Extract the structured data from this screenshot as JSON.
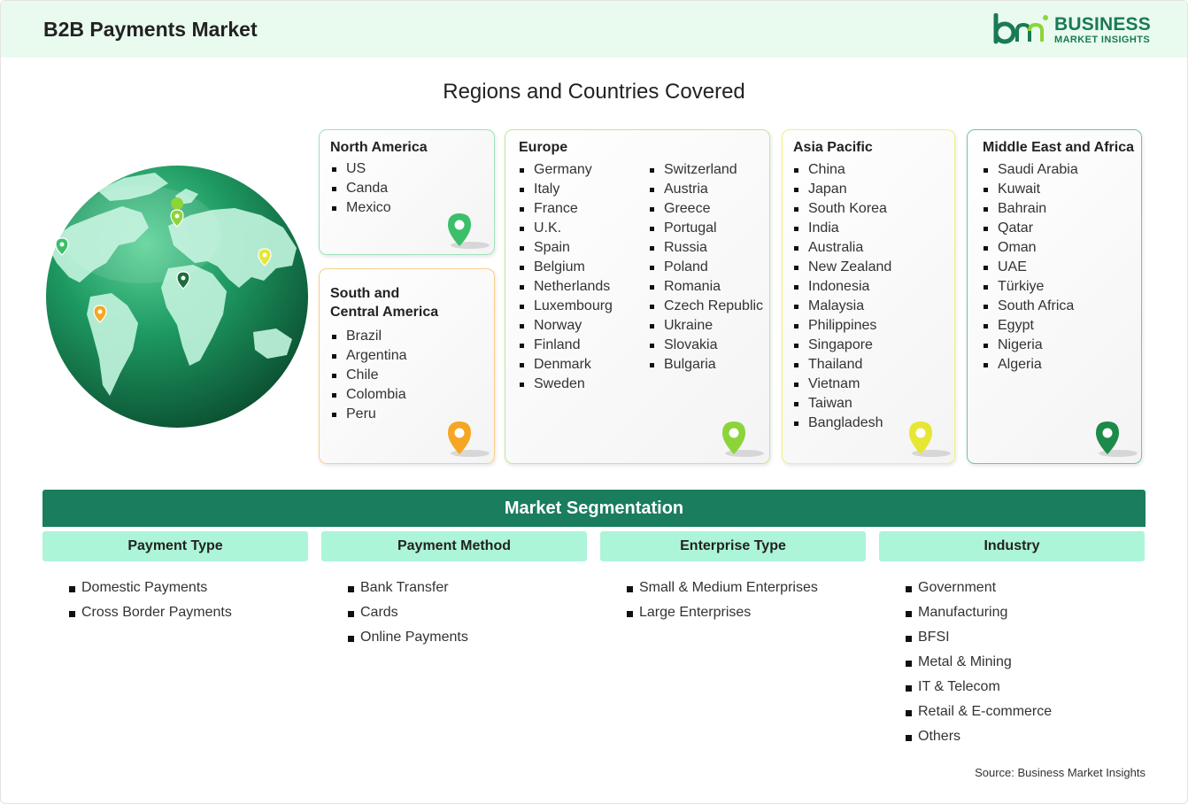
{
  "header": {
    "title": "B2B Payments Market"
  },
  "logo": {
    "line1": "BUSINESS",
    "line2": "MARKET INSIGHTS",
    "color": "#1a7a55"
  },
  "regions_title": "Regions and Countries Covered",
  "regions": {
    "north_america": {
      "title": "North America",
      "items": [
        "US",
        "Canda",
        "Mexico"
      ],
      "pin_color": "#3cbf6a"
    },
    "south_america": {
      "title_line1": "South and",
      "title_line2": "Central America",
      "items": [
        "Brazil",
        "Argentina",
        "Chile",
        "Colombia",
        "Peru"
      ],
      "pin_color": "#f5a623"
    },
    "europe": {
      "title": "Europe",
      "col1": [
        "Germany",
        "Italy",
        "France",
        "U.K.",
        "Spain",
        "Belgium",
        "Netherlands",
        "Luxembourg",
        "Norway",
        "Finland",
        "Denmark",
        "Sweden"
      ],
      "col2": [
        "Switzerland",
        "Austria",
        "Greece",
        "Portugal",
        "Russia",
        "Poland",
        "Romania",
        "Czech Republic",
        "Ukraine",
        "Slovakia",
        "Bulgaria"
      ],
      "pin_color": "#8cd43a"
    },
    "asia_pacific": {
      "title": "Asia Pacific",
      "items": [
        "China",
        "Japan",
        "South Korea",
        "India",
        "Australia",
        "New Zealand",
        "Indonesia",
        "Malaysia",
        "Philippines",
        "Singapore",
        "Thailand",
        "Vietnam",
        "Taiwan",
        "Bangladesh"
      ],
      "pin_color": "#e6e635"
    },
    "mea": {
      "title": "Middle East and Africa",
      "items": [
        "Saudi Arabia",
        "Kuwait",
        "Bahrain",
        "Qatar",
        "Oman",
        "UAE",
        "Türkiye",
        "South Africa",
        "Egypt",
        "Nigeria",
        "Algeria"
      ],
      "pin_color": "#1c8a48"
    }
  },
  "segmentation": {
    "title": "Market Segmentation",
    "columns": [
      {
        "header": "Payment Type",
        "items": [
          "Domestic Payments",
          "Cross Border Payments"
        ]
      },
      {
        "header": "Payment Method",
        "items": [
          "Bank Transfer",
          "Cards",
          "Online Payments"
        ]
      },
      {
        "header": "Enterprise Type",
        "items": [
          "Small & Medium Enterprises",
          "Large Enterprises"
        ]
      },
      {
        "header": "Industry",
        "items": [
          "Government",
          "Manufacturing",
          "BFSI",
          "Metal & Mining",
          "IT & Telecom",
          "Retail & E-commerce",
          "Others"
        ]
      }
    ]
  },
  "source": "Source: Business Market Insights",
  "icons": [
    "globe-icon",
    "map-pin-icon",
    "logo-icon"
  ]
}
